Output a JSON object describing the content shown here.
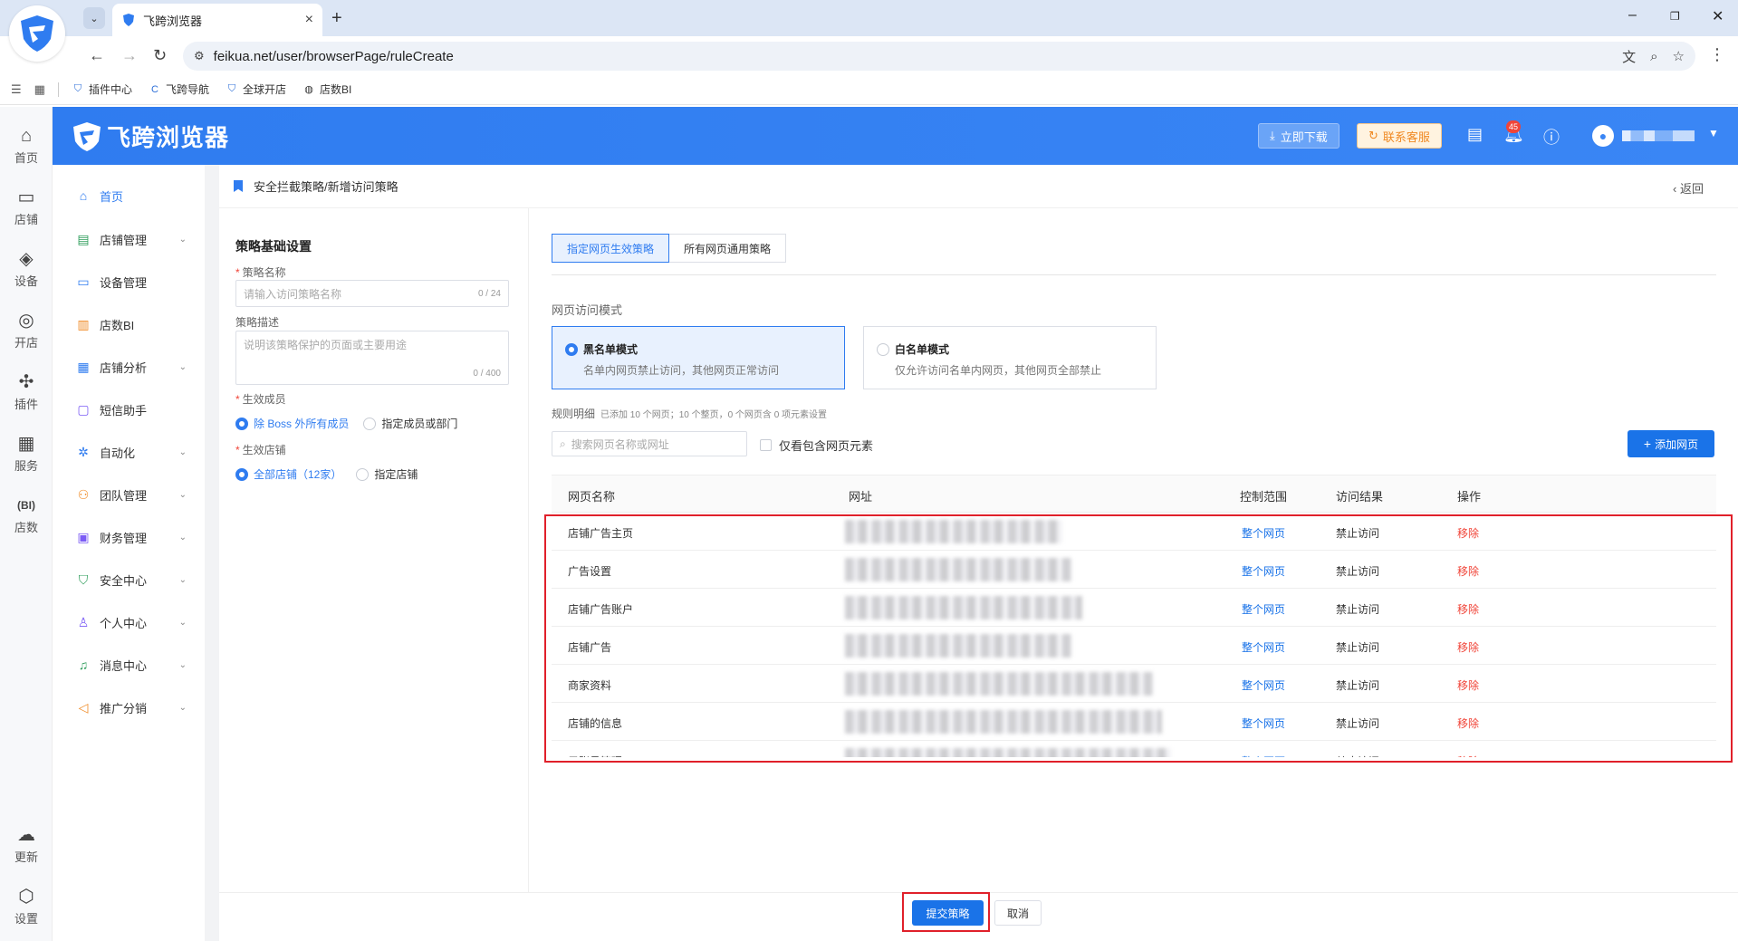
{
  "browser": {
    "tab_title": "飞跨浏览器",
    "url": "feikua.net/user/browserPage/ruleCreate",
    "bookmarks": [
      "插件中心",
      "飞跨导航",
      "全球开店",
      "店数BI"
    ]
  },
  "rail": {
    "items": [
      "首页",
      "店铺",
      "设备",
      "开店",
      "插件",
      "服务",
      "店数"
    ],
    "bottom": [
      "更新",
      "设置"
    ]
  },
  "header": {
    "brand": "飞跨浏览器",
    "download": "立即下载",
    "support": "联系客服",
    "badge_count": "45"
  },
  "sidebar": {
    "items": [
      {
        "label": "首页",
        "icon": "home-icon"
      },
      {
        "label": "店铺管理",
        "icon": "store-icon"
      },
      {
        "label": "设备管理",
        "icon": "device-icon"
      },
      {
        "label": "店数BI",
        "icon": "bar-chart-icon"
      },
      {
        "label": "店铺分析",
        "icon": "grid-icon"
      },
      {
        "label": "短信助手",
        "icon": "message-icon"
      },
      {
        "label": "自动化",
        "icon": "automation-icon"
      },
      {
        "label": "团队管理",
        "icon": "team-icon"
      },
      {
        "label": "财务管理",
        "icon": "wallet-icon"
      },
      {
        "label": "安全中心",
        "icon": "shield-icon"
      },
      {
        "label": "个人中心",
        "icon": "user-icon"
      },
      {
        "label": "消息中心",
        "icon": "bell-icon"
      },
      {
        "label": "推广分销",
        "icon": "megaphone-icon"
      }
    ]
  },
  "breadcrumb": "安全拦截策略/新增访问策略",
  "back": "返回",
  "form": {
    "section_title": "策略基础设置",
    "name_label": "策略名称",
    "name_placeholder": "请输入访问策略名称",
    "name_count": "0 / 24",
    "desc_label": "策略描述",
    "desc_placeholder": "说明该策略保护的页面或主要用途",
    "desc_count": "0 / 400",
    "members_label": "生效成员",
    "members_opt1": "除 Boss 外所有成员",
    "members_opt2": "指定成员或部门",
    "stores_label": "生效店铺",
    "stores_opt1": "全部店铺（12家）",
    "stores_opt2": "指定店铺"
  },
  "rules": {
    "tab_active": "指定网页生效策略",
    "tab_other": "所有网页通用策略",
    "mode_label": "网页访问模式",
    "blacklist_title": "黑名单模式",
    "blacklist_desc": "名单内网页禁止访问，其他网页正常访问",
    "whitelist_title": "白名单模式",
    "whitelist_desc": "仅允许访问名单内网页，其他网页全部禁止",
    "detail_label": "规则明细",
    "detail_note": "已添加 10 个网页；10 个整页，0 个网页含 0 项元素设置",
    "search_placeholder": "搜索网页名称或网址",
    "only_elements": "仅看包含网页元素",
    "add_button": "添加网页",
    "columns": [
      "网页名称",
      "网址",
      "控制范围",
      "访问结果",
      "操作"
    ],
    "rows": [
      {
        "name": "店铺广告主页",
        "scope": "整个网页",
        "result": "禁止访问",
        "action": "移除"
      },
      {
        "name": "广告设置",
        "scope": "整个网页",
        "result": "禁止访问",
        "action": "移除"
      },
      {
        "name": "店铺广告账户",
        "scope": "整个网页",
        "result": "禁止访问",
        "action": "移除"
      },
      {
        "name": "店铺广告",
        "scope": "整个网页",
        "result": "禁止访问",
        "action": "移除"
      },
      {
        "name": "商家资料",
        "scope": "整个网页",
        "result": "禁止访问",
        "action": "移除"
      },
      {
        "name": "店铺的信息",
        "scope": "整个网页",
        "result": "禁止访问",
        "action": "移除"
      },
      {
        "name": "子账号管理",
        "scope": "整个网页",
        "result": "禁止访问",
        "action": "移除"
      }
    ]
  },
  "footer": {
    "submit": "提交策略",
    "cancel": "取消"
  }
}
